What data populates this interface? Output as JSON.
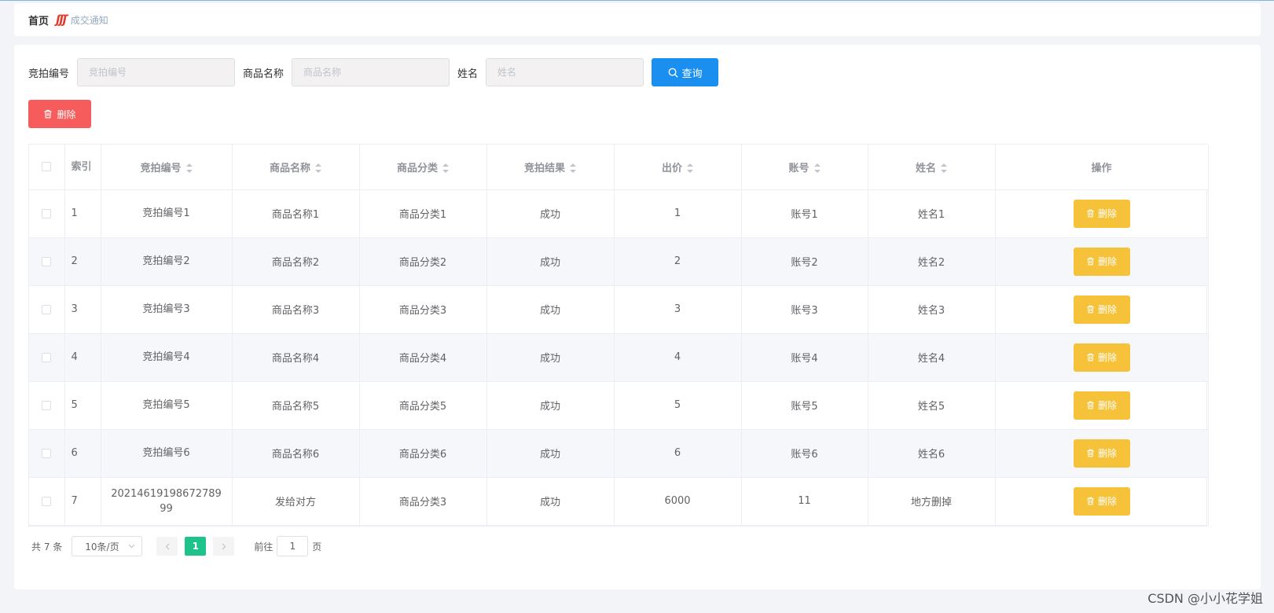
{
  "breadcrumb": {
    "home": "首页",
    "separator": "ʃʃʃ",
    "current": "成交通知"
  },
  "search": {
    "fields": [
      {
        "label": "竞拍编号",
        "placeholder": "竞拍编号"
      },
      {
        "label": "商品名称",
        "placeholder": "商品名称"
      },
      {
        "label": "姓名",
        "placeholder": "姓名"
      }
    ],
    "query_label": "查询"
  },
  "toolbar": {
    "delete_label": "删除"
  },
  "table": {
    "columns": [
      "索引",
      "竞拍编号",
      "商品名称",
      "商品分类",
      "竞拍结果",
      "出价",
      "账号",
      "姓名",
      "操作"
    ],
    "rows": [
      {
        "index": "1",
        "auction_no": "竞拍编号1",
        "product": "商品名称1",
        "category": "商品分类1",
        "result": "成功",
        "price": "1",
        "account": "账号1",
        "name": "姓名1"
      },
      {
        "index": "2",
        "auction_no": "竞拍编号2",
        "product": "商品名称2",
        "category": "商品分类2",
        "result": "成功",
        "price": "2",
        "account": "账号2",
        "name": "姓名2"
      },
      {
        "index": "3",
        "auction_no": "竞拍编号3",
        "product": "商品名称3",
        "category": "商品分类3",
        "result": "成功",
        "price": "3",
        "account": "账号3",
        "name": "姓名3"
      },
      {
        "index": "4",
        "auction_no": "竞拍编号4",
        "product": "商品名称4",
        "category": "商品分类4",
        "result": "成功",
        "price": "4",
        "account": "账号4",
        "name": "姓名4"
      },
      {
        "index": "5",
        "auction_no": "竞拍编号5",
        "product": "商品名称5",
        "category": "商品分类5",
        "result": "成功",
        "price": "5",
        "account": "账号5",
        "name": "姓名5"
      },
      {
        "index": "6",
        "auction_no": "竞拍编号6",
        "product": "商品名称6",
        "category": "商品分类6",
        "result": "成功",
        "price": "6",
        "account": "账号6",
        "name": "姓名6"
      },
      {
        "index": "7",
        "auction_no": "2021461919867278999",
        "product": "发给对方",
        "category": "商品分类3",
        "result": "成功",
        "price": "6000",
        "account": "11",
        "name": "地方删掉"
      }
    ],
    "row_action_label": "删除"
  },
  "pagination": {
    "total_text": "共 7 条",
    "page_size": "10条/页",
    "current_page": "1",
    "goto_prefix": "前往",
    "goto_value": "1",
    "goto_suffix": "页"
  },
  "watermark": "CSDN @小小花学姐",
  "colors": {
    "primary": "#1a8ff0",
    "danger": "#f65c5c",
    "warning": "#f5c23a",
    "pager_active": "#1ec28b"
  }
}
